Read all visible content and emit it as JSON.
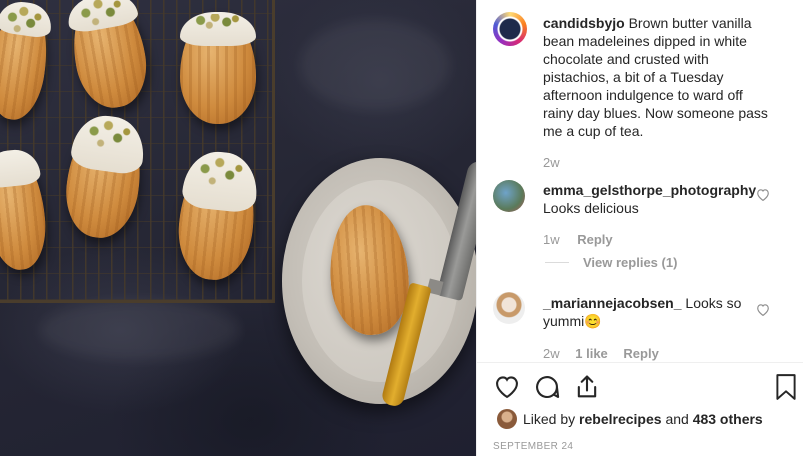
{
  "post": {
    "author": "candidsbyjo",
    "caption": "Brown butter vanilla bean madeleines dipped in white chocolate and crusted with pistachios, a bit of a Tuesday afternoon indulgence to ward off rainy day blues. Now someone pass me a cup of tea.",
    "age": "2w"
  },
  "comments": [
    {
      "username": "emma_gelsthorpe_photography",
      "text": "Looks delicious",
      "age": "1w",
      "reply_label": "Reply",
      "view_replies": "View replies (1)"
    },
    {
      "username": "_mariannejacobsen_",
      "text": "Looks so yummi😊",
      "age": "2w",
      "likes": "1 like",
      "reply_label": "Reply"
    }
  ],
  "likes": {
    "prefix": "Liked by",
    "user": "rebelrecipes",
    "middle": "and",
    "count": "483 others"
  },
  "date": "SEPTEMBER 24",
  "icons": {
    "like": "heart-icon",
    "comment": "comment-icon",
    "share": "share-icon",
    "save": "bookmark-icon",
    "comment_like": "heart-outline-icon"
  }
}
